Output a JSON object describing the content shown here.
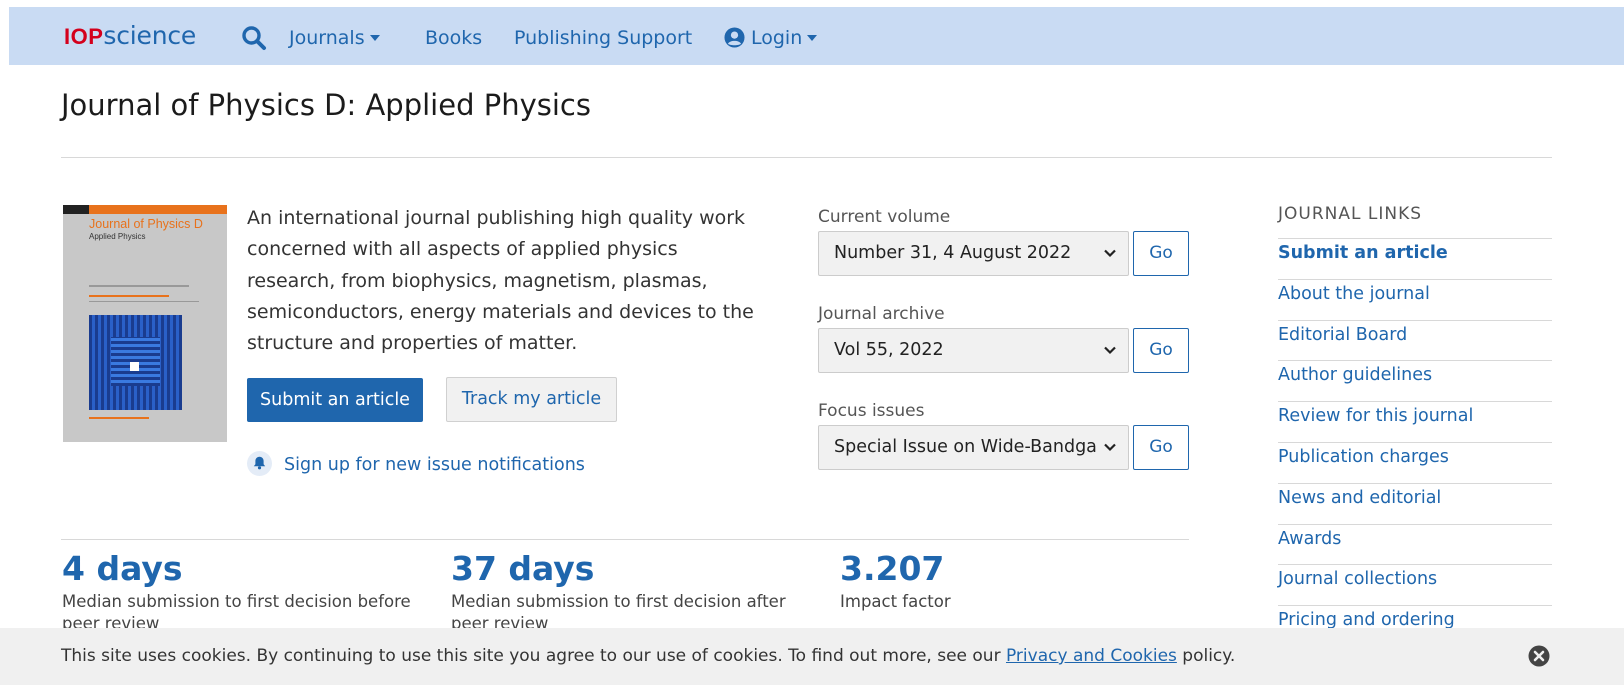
{
  "brand": {
    "iop": "IOP",
    "science": "science"
  },
  "nav": {
    "journals": "Journals",
    "books": "Books",
    "publishing_support": "Publishing Support",
    "login": "Login"
  },
  "page_title": "Journal of Physics D: Applied Physics",
  "cover": {
    "journal_name": "Journal of Physics D",
    "subtitle": "Applied Physics"
  },
  "description": "An international journal publishing high quality work concerned with all aspects of applied physics research, from biophysics, magnetism, plasmas, semiconductors, energy materials and devices to the structure and properties of matter.",
  "buttons": {
    "submit": "Submit an article",
    "track": "Track my article"
  },
  "notify": "Sign up for new issue notifications",
  "selects": {
    "current_volume": {
      "label": "Current volume",
      "value": "Number 31, 4 August 2022"
    },
    "journal_archive": {
      "label": "Journal archive",
      "value": "Vol 55, 2022"
    },
    "focus_issues": {
      "label": "Focus issues",
      "value": "Special Issue on Wide-Bandgap Semiconductors"
    },
    "go": "Go"
  },
  "journal_links": {
    "heading": "JOURNAL LINKS",
    "items": [
      "Submit an article",
      "About the journal",
      "Editorial Board",
      "Author guidelines",
      "Review for this journal",
      "Publication charges",
      "News and editorial",
      "Awards",
      "Journal collections",
      "Pricing and ordering"
    ]
  },
  "stats": [
    {
      "value": "4 days",
      "label": "Median submission to first decision before peer review"
    },
    {
      "value": "37 days",
      "label": "Median submission to first decision after peer review"
    },
    {
      "value": "3.207",
      "label": "Impact factor"
    }
  ],
  "cookie": {
    "text_before": "This site uses cookies. By continuing to use this site you agree to our use of cookies. To find out more, see our ",
    "link": "Privacy and Cookies",
    "text_after": " policy."
  },
  "colors": {
    "nav_bg": "#c9dbf3",
    "link": "#1f66ad",
    "brand_red": "#d4001c",
    "cookie_bg": "#f0f0f0"
  }
}
